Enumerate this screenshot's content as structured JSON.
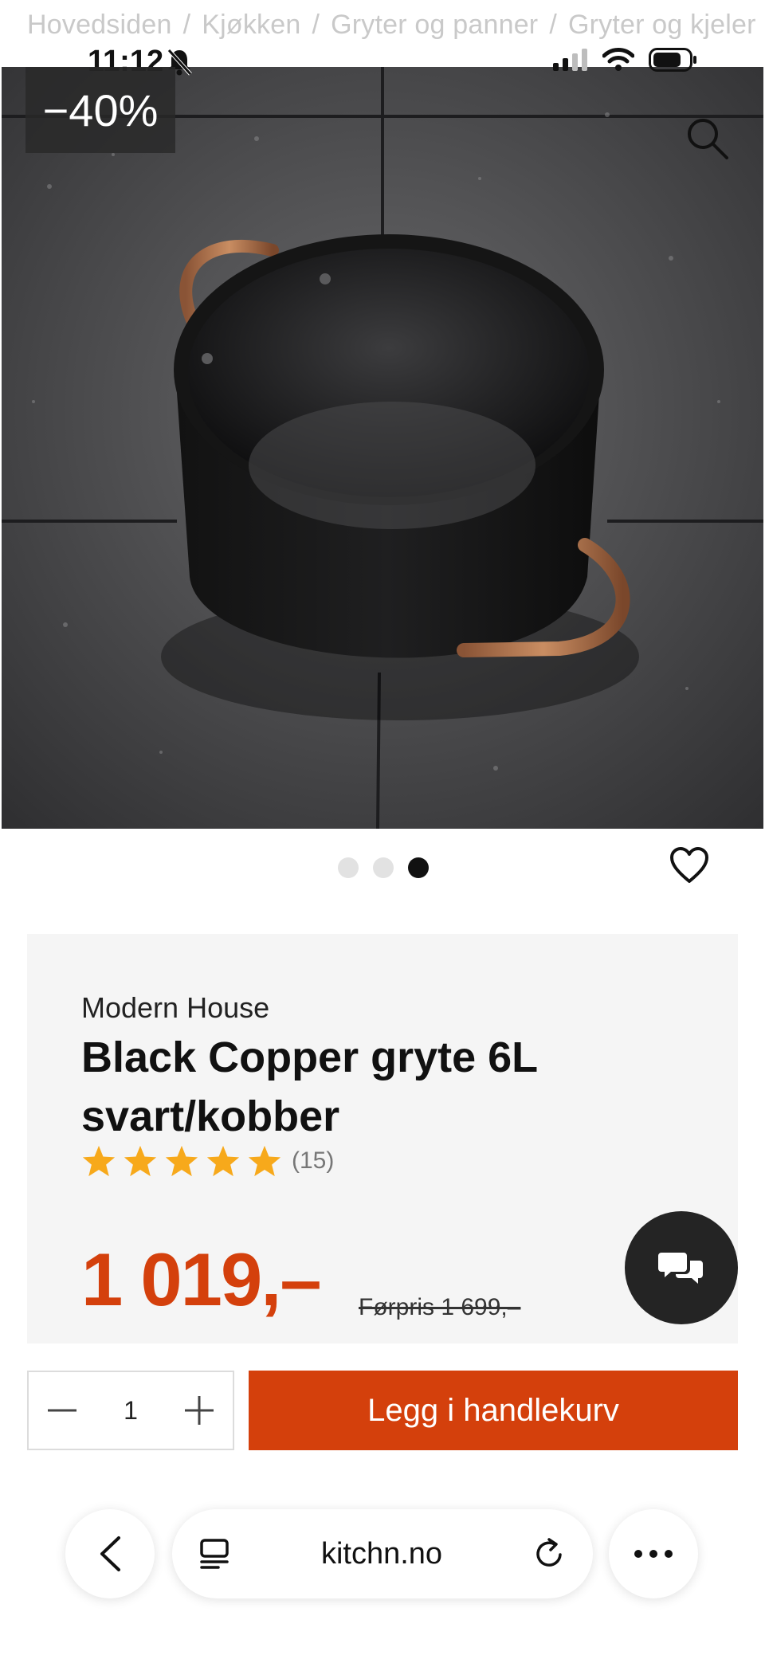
{
  "breadcrumb": [
    "Hovedsiden",
    "Kjøkken",
    "Gryter og panner",
    "Gryter og kjeler"
  ],
  "status": {
    "time": "11:12"
  },
  "hero": {
    "discount_badge": "−40%"
  },
  "gallery": {
    "dots": 3,
    "active_index": 2
  },
  "product": {
    "brand": "Modern House",
    "title": "Black Copper gryte 6L svart/kobber",
    "rating_stars": 5,
    "rating_count": "(15)",
    "price": "1 019,–",
    "previous_price": "Førpris 1 699,–"
  },
  "purchase": {
    "quantity": "1",
    "add_to_cart_label": "Legg i handlekurv"
  },
  "browser": {
    "url": "kitchn.no"
  },
  "colors": {
    "accent": "#d4400c",
    "star": "#f7a91b",
    "chat_bg": "#242424"
  }
}
